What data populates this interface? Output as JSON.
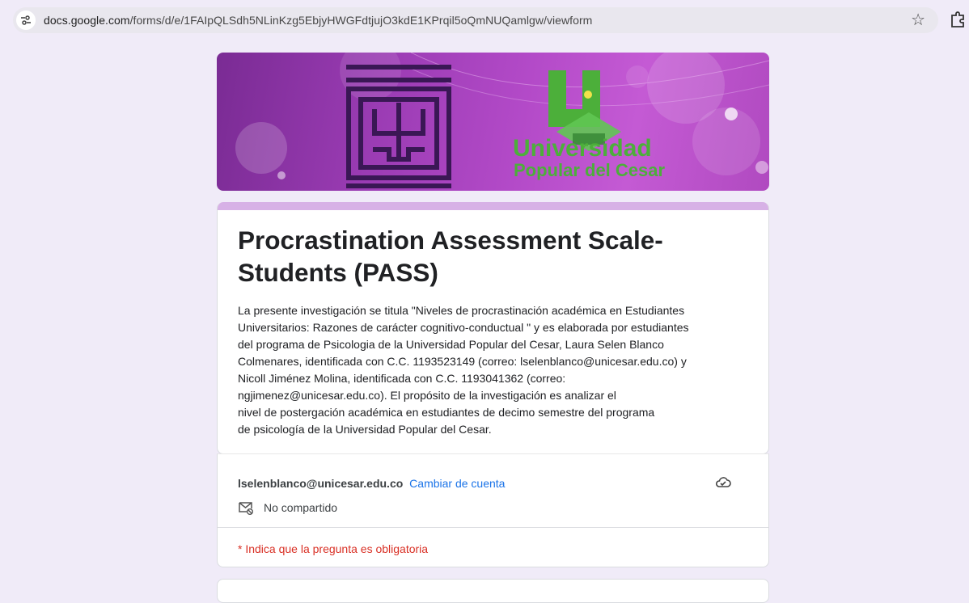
{
  "browser": {
    "url_host": "docs.google.com",
    "url_path": "/forms/d/e/1FAIpQLSdh5NLinKzg5EbjyHWGFdtjujO3kdE1KPrqil5oQmNUQamlgw/viewform",
    "icons": [
      "site-settings-icon",
      "bookmark-star-icon",
      "extensions-icon"
    ]
  },
  "header": {
    "logo_line1": "Universidad",
    "logo_line2": "Popular del Cesar",
    "colors": {
      "banner": "#9b3cb4",
      "logo_green": "#4caf3a"
    }
  },
  "form": {
    "title": "Procrastination Assessment Scale-Students (PASS)",
    "description": "La presente investigación se titula \"Niveles de procrastinación académica en Estudiantes\nUniversitarios: Razones de carácter cognitivo-conductual \"  y es elaborada por estudiantes\ndel programa de Psicologia de la Universidad Popular del Cesar, Laura Selen Blanco\nColmenares, identificada con C.C. 1193523149 (correo: lselenblanco@unicesar.edu.co) y\nNicoll Jiménez Molina, identificada con C.C. 1193041362 (correo:\nngjimenez@unicesar.edu.co). El propósito de la investigación es analizar el\nnivel de postergación académica en estudiantes de decimo semestre del programa\nde psicología de la Universidad Popular del Cesar.",
    "accent_color": "#d7b1e6"
  },
  "account": {
    "email": "lselenblanco@unicesar.edu.co",
    "switch_label": "Cambiar de cuenta",
    "share_status": "No compartido",
    "required_note": "* Indica que la pregunta es obligatoria"
  }
}
